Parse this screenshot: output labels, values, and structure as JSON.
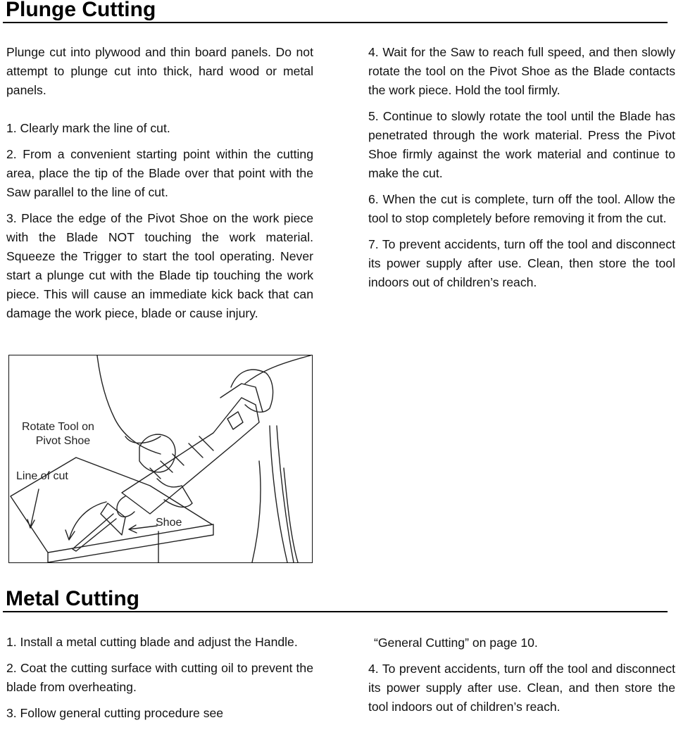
{
  "sections": {
    "plunge": {
      "title": "Plunge Cutting",
      "intro": "Plunge cut into plywood and thin board panels. Do not attempt to plunge cut into thick, hard wood or metal panels.",
      "steps": [
        "1. Clearly mark the line of cut.",
        "2. From a convenient starting point within the cutting area, place the tip of the Blade over that point with the Saw parallel to the line of cut.",
        "3. Place the edge of the Pivot Shoe on the work piece with the Blade NOT touching the work material. Squeeze the Trigger to start the tool operating. Never start a plunge cut with the Blade tip touching the work piece. This will cause an immediate kick back that can damage the work piece, blade or cause injury.",
        "4. Wait for the Saw to reach full speed, and then slowly rotate the tool on the Pivot Shoe as the Blade contacts the work piece. Hold the tool firmly.",
        "5. Continue to slowly rotate the tool until the Blade has penetrated through the work material. Press the Pivot Shoe firmly against the work material and continue to make the cut.",
        "6. When the cut is complete, turn off the tool. Allow the tool to stop completely before removing it from the cut.",
        "7. To prevent accidents, turn off the tool and disconnect its power supply after use. Clean, then store the tool indoors out of children’s reach."
      ],
      "illustration": {
        "label_rotate_line1": "Rotate Tool on",
        "label_rotate_line2": "Pivot Shoe",
        "label_line_of_cut": "Line of cut",
        "label_shoe": "Shoe"
      }
    },
    "metal": {
      "title": "Metal Cutting",
      "steps": [
        "1. Install a metal cutting blade and adjust the Handle.",
        "2. Coat the cutting surface with cutting oil to prevent the blade from overheating.",
        "3. Follow general cutting procedure see",
        "“General Cutting” on page 10.",
        "4. To prevent accidents, turn off the tool and disconnect its power supply after use. Clean, and then store the tool indoors out of children’s reach."
      ]
    }
  }
}
